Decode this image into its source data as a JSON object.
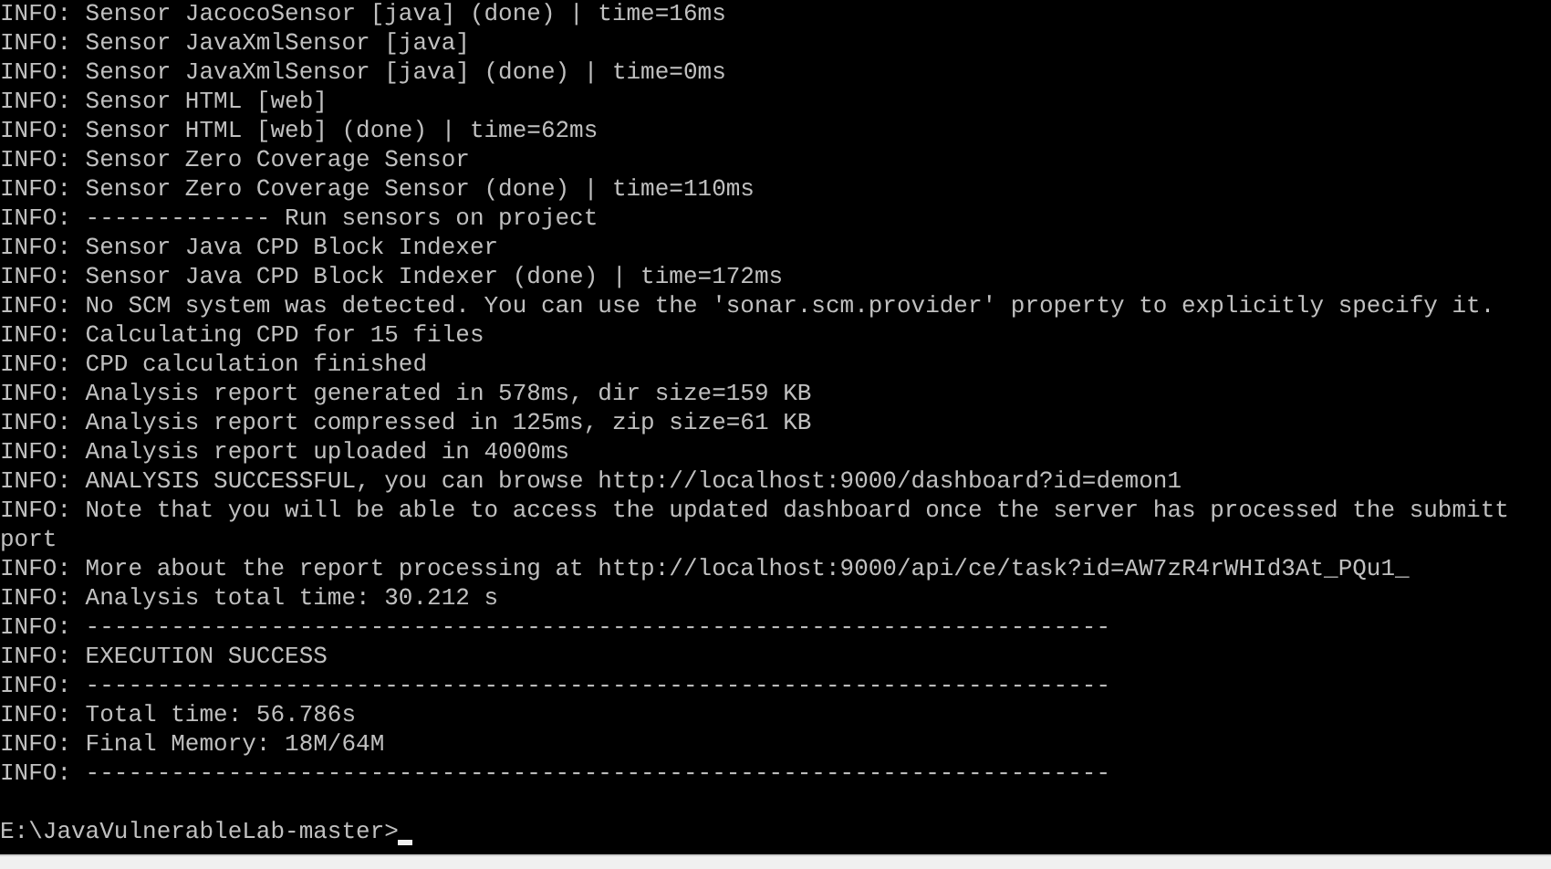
{
  "console": {
    "lines": [
      "INFO: Sensor JacocoSensor [java] (done) | time=16ms",
      "INFO: Sensor JavaXmlSensor [java]",
      "INFO: Sensor JavaXmlSensor [java] (done) | time=0ms",
      "INFO: Sensor HTML [web]",
      "INFO: Sensor HTML [web] (done) | time=62ms",
      "INFO: Sensor Zero Coverage Sensor",
      "INFO: Sensor Zero Coverage Sensor (done) | time=110ms",
      "INFO: ------------- Run sensors on project",
      "INFO: Sensor Java CPD Block Indexer",
      "INFO: Sensor Java CPD Block Indexer (done) | time=172ms",
      "INFO: No SCM system was detected. You can use the 'sonar.scm.provider' property to explicitly specify it.",
      "INFO: Calculating CPD for 15 files",
      "INFO: CPD calculation finished",
      "INFO: Analysis report generated in 578ms, dir size=159 KB",
      "INFO: Analysis report compressed in 125ms, zip size=61 KB",
      "INFO: Analysis report uploaded in 4000ms",
      "INFO: ANALYSIS SUCCESSFUL, you can browse http://localhost:9000/dashboard?id=demon1",
      "INFO: Note that you will be able to access the updated dashboard once the server has processed the submitt",
      "port",
      "INFO: More about the report processing at http://localhost:9000/api/ce/task?id=AW7zR4rWHId3At_PQu1_",
      "INFO: Analysis total time: 30.212 s",
      "INFO: ------------------------------------------------------------------------",
      "INFO: EXECUTION SUCCESS",
      "INFO: ------------------------------------------------------------------------",
      "INFO: Total time: 56.786s",
      "INFO: Final Memory: 18M/64M",
      "INFO: ------------------------------------------------------------------------"
    ],
    "prompt": "E:\\JavaVulnerableLab-master>"
  }
}
